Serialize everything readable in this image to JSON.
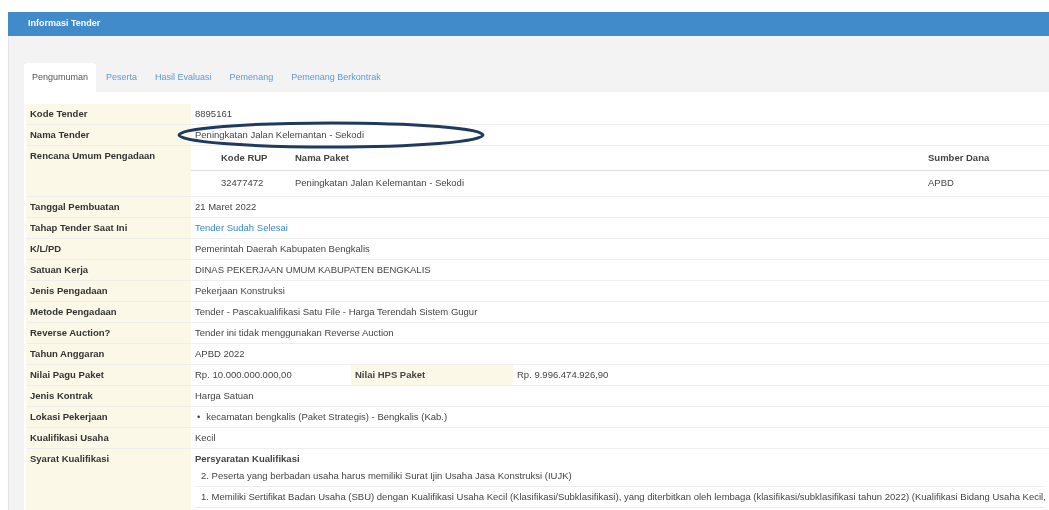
{
  "panel": {
    "title": "Informasi Tender"
  },
  "tabs": [
    {
      "label": "Pengumuman",
      "selected": true
    },
    {
      "label": "Peserta",
      "selected": false
    },
    {
      "label": "Hasil Evaluasi",
      "selected": false
    },
    {
      "label": "Pemenang",
      "selected": false
    },
    {
      "label": "Pemenang Berkontrak",
      "selected": false
    }
  ],
  "rows": [
    {
      "kind": "text",
      "label": "Kode Tender",
      "value": "8895161"
    },
    {
      "kind": "text",
      "label": "Nama Tender",
      "value": "Peningkatan Jalan Kelemantan - Sekodi"
    },
    {
      "kind": "rup",
      "label": "Rencana Umum Pengadaan",
      "columns": [
        "Kode RUP",
        "Nama Paket",
        "Sumber Dana"
      ],
      "cells": [
        "32477472",
        "Peningkatan Jalan Kelemantan - Sekodi",
        "APBD"
      ]
    },
    {
      "kind": "text",
      "label": "Tanggal Pembuatan",
      "value": "21 Maret 2022"
    },
    {
      "kind": "link",
      "label": "Tahap Tender Saat Ini",
      "value": "Tender Sudah Selesai"
    },
    {
      "kind": "text",
      "label": "K/L/PD",
      "value": "Pemerintah Daerah Kabupaten Bengkalis"
    },
    {
      "kind": "text",
      "label": "Satuan Kerja",
      "value": "DINAS PEKERJAAN UMUM KABUPATEN BENGKALIS"
    },
    {
      "kind": "text",
      "label": "Jenis Pengadaan",
      "value": "Pekerjaan Konstruksi"
    },
    {
      "kind": "text",
      "label": "Metode Pengadaan",
      "value": "Tender - Pascakualifikasi Satu File - Harga Terendah Sistem Gugur"
    },
    {
      "kind": "text",
      "label": "Reverse Auction?",
      "value": "Tender ini tidak menggunakan Reverse Auction"
    },
    {
      "kind": "text",
      "label": "Tahun Anggaran",
      "value": "APBD 2022"
    },
    {
      "kind": "pagu",
      "label": "Nilai Pagu Paket",
      "value": "Rp. 10.000.000.000,00",
      "label_2": "Nilai HPS Paket",
      "value_2": "Rp. 9.996.474.926,90"
    },
    {
      "kind": "text",
      "label": "Jenis Kontrak",
      "value": "Harga Satuan"
    },
    {
      "kind": "list",
      "label": "Lokasi Pekerjaan",
      "marker": "•",
      "items": [
        "kecamatan bengkalis (Paket Strategis) - Bengkalis (Kab.)"
      ]
    },
    {
      "kind": "text",
      "label": "Kualifikasi Usaha",
      "value": "Kecil"
    },
    {
      "kind": "syarat",
      "label": "Syarat Kualifikasi",
      "heading": "Persyaratan Kualifikasi",
      "lines": [
        "2. Peserta yang berbadan usaha harus memiliki Surat Ijin Usaha Jasa Konstruksi (IUJK)",
        "1. Memiliki Sertifikat Badan Usaha (SBU) dengan Kualifikasi Usaha Kecil (Klasifikasi/Subklasifikasi), yang diterbitkan oleh lembaga (klasifikasi/subklasifikasi tahun 2022) (Kualifikasi Bidang Usaha Kecil,"
      ]
    }
  ],
  "annotation": {
    "kind": "ellipse",
    "color": "#1f3a5f"
  }
}
